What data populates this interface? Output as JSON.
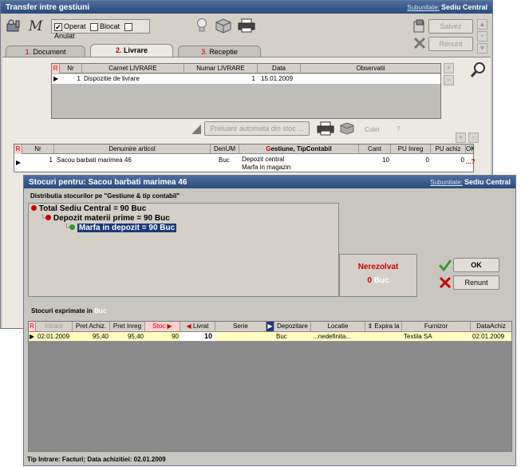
{
  "main": {
    "title": "Transfer intre gestiuni",
    "subunit_label": "Subunitate:",
    "subunit_value": "Sediu Central",
    "flags": [
      {
        "label": "Operat",
        "checked": true
      },
      {
        "label": "Blocat",
        "checked": false
      },
      {
        "label": "Anulat",
        "checked": false
      }
    ],
    "save_label": "Salvez",
    "cancel_label": "Renunt",
    "tabs": [
      {
        "num": "1.",
        "label": "Document"
      },
      {
        "num": "2.",
        "label": "Livrare"
      },
      {
        "num": "3.",
        "label": "Receptie"
      }
    ],
    "livrare_grid": {
      "headers": [
        "R",
        "Nr",
        "Carnet LIVRARE",
        "Numar LIVRARE",
        "Data",
        "Observatii"
      ],
      "row": {
        "nr": "1",
        "carnet": "Dispozitie de livrare",
        "numar": "1",
        "data": "15.01.2009",
        "obs": ""
      }
    },
    "preluare_label": "Preluare automata din stoc ...",
    "colet_label": "Colet",
    "question": "?",
    "articles_grid": {
      "headers": [
        "R",
        "Nr",
        "Denumire articol",
        "DenUM",
        "Gestiune, TipContabil",
        "Cant",
        "PU Inreg",
        "PU achiz",
        "OK"
      ],
      "gestiune_first_letter": "G",
      "gestiune_rest": "estiune, TipContabil",
      "row": {
        "nr": "1",
        "denumire": "Sacou barbati marimea 46",
        "um": "Buc",
        "gestiune": "Depozit central",
        "tip": "Marfa in magazin",
        "cant": "10",
        "pu_inreg": "0",
        "pu_achiz": "0",
        "ok": "...?"
      }
    }
  },
  "dialog": {
    "title": "Stocuri pentru: Sacou barbati marimea 46",
    "subunit_label": "Subunitate:",
    "subunit_value": "Sediu Central",
    "distributie": "Distributia stocurilor pe \"Gestiune & tip contabil\"",
    "tree": [
      "Total Sediu Central = 90 Buc",
      "Depozit materii prime = 90 Buc",
      "Marfa in depozit = 90 Buc"
    ],
    "nerezolvat_label": "Nerezolvat",
    "nerezolvat_value": "0",
    "nerezolvat_unit": "Buc",
    "ok_label": "OK",
    "renunt_label": "Renunt",
    "stocuri_label": "Stocuri exprimate in",
    "stocuri_unit": "Buc",
    "grid": {
      "headers": [
        "R",
        "Intrare",
        "Pret Achiz.",
        "Pret Inreg",
        "Stoc",
        "Livrat",
        "Serie",
        "",
        "Depozitare",
        "Locatie",
        "Expira la",
        "Furnizor",
        "DataAchiz"
      ],
      "row": {
        "intrare": "02.01.2009",
        "pret_achiz": "95,40",
        "pret_inreg": "95,40",
        "stoc": "90",
        "livrat": "10",
        "serie": "",
        "depozitare": "Buc",
        "locatie": "...nedefinita...",
        "expira": "",
        "furnizor": "Textila SA",
        "data_achiz": "02.01.2009"
      }
    },
    "status": "Tip Intrare: Facturi; Data achizitiei: 02.01.2009"
  },
  "colors": {
    "title_bar": "#3a5a8c",
    "accent_red": "#cc0000",
    "selected_row": "#ffffc0",
    "tree_selected": "#1c3a7a"
  }
}
